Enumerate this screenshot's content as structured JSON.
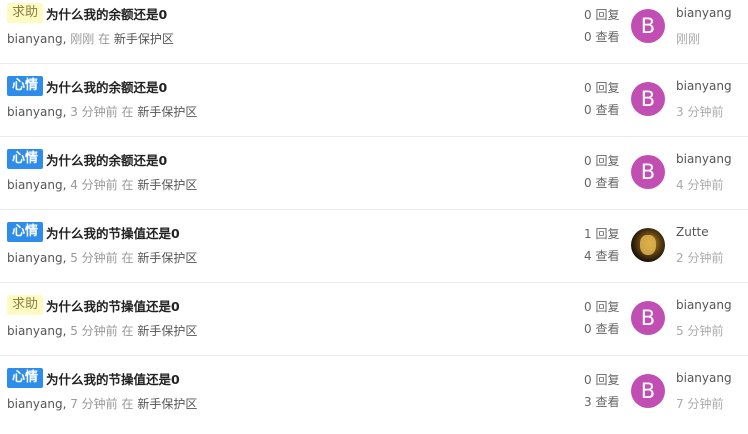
{
  "topics": [
    {
      "tag": "求助",
      "tag_type": "help",
      "title": "为什么我的余额还是0",
      "author": "bianyang",
      "time": "刚刚",
      "in_label": "在",
      "node": "新手保护区",
      "replies": "0 回复",
      "views": "0 查看",
      "avatar_letter": "B",
      "last_user": "bianyang",
      "last_time": "刚刚"
    },
    {
      "tag": "心情",
      "tag_type": "mood",
      "title": "为什么我的余额还是0",
      "author": "bianyang",
      "time": "3 分钟前",
      "in_label": "在",
      "node": "新手保护区",
      "replies": "0 回复",
      "views": "0 查看",
      "avatar_letter": "B",
      "last_user": "bianyang",
      "last_time": "3 分钟前"
    },
    {
      "tag": "心情",
      "tag_type": "mood",
      "title": "为什么我的余额还是0",
      "author": "bianyang",
      "time": "4 分钟前",
      "in_label": "在",
      "node": "新手保护区",
      "replies": "0 回复",
      "views": "0 查看",
      "avatar_letter": "B",
      "last_user": "bianyang",
      "last_time": "4 分钟前"
    },
    {
      "tag": "心情",
      "tag_type": "mood",
      "title": "为什么我的节操值还是0",
      "author": "bianyang",
      "time": "5 分钟前",
      "in_label": "在",
      "node": "新手保护区",
      "replies": "1 回复",
      "views": "4 查看",
      "avatar_letter": "",
      "avatar_photo": true,
      "last_user": "Zutte",
      "last_time": "2 分钟前"
    },
    {
      "tag": "求助",
      "tag_type": "help",
      "title": "为什么我的节操值还是0",
      "author": "bianyang",
      "time": "5 分钟前",
      "in_label": "在",
      "node": "新手保护区",
      "replies": "0 回复",
      "views": "0 查看",
      "avatar_letter": "B",
      "last_user": "bianyang",
      "last_time": "5 分钟前"
    },
    {
      "tag": "心情",
      "tag_type": "mood",
      "title": "为什么我的节操值还是0",
      "author": "bianyang",
      "time": "7 分钟前",
      "in_label": "在",
      "node": "新手保护区",
      "replies": "0 回复",
      "views": "3 查看",
      "avatar_letter": "B",
      "last_user": "bianyang",
      "last_time": "7 分钟前"
    }
  ],
  "colors": {
    "help_badge_bg": "#fefbc2",
    "mood_badge_bg": "#2f8dea",
    "avatar_bg": "#c14fb3"
  },
  "icons": {
    "avatar_photo": "user-photo-icon"
  }
}
